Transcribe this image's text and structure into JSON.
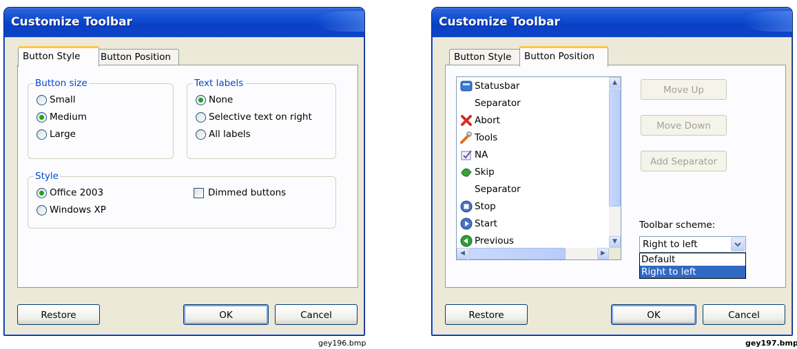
{
  "left_dialog": {
    "title": "Customize Toolbar",
    "tabs": [
      "Button Style",
      "Button Position"
    ],
    "active_tab": "Button Style",
    "button_size": {
      "legend": "Button size",
      "options": [
        "Small",
        "Medium",
        "Large"
      ],
      "selected": "Medium"
    },
    "text_labels": {
      "legend": "Text labels",
      "options": [
        "None",
        "Selective text on right",
        "All labels"
      ],
      "selected": "None"
    },
    "style": {
      "legend": "Style",
      "options": [
        "Office 2003",
        "Windows XP"
      ],
      "selected": "Office 2003",
      "dimmed_label": "Dimmed buttons",
      "dimmed_checked": false
    },
    "buttons": {
      "restore": "Restore",
      "ok": "OK",
      "cancel": "Cancel"
    },
    "caption": "gey196.bmp"
  },
  "right_dialog": {
    "title": "Customize Toolbar",
    "tabs": [
      "Button Style",
      "Button Position"
    ],
    "active_tab": "Button Position",
    "list_items": [
      {
        "label": "Statusbar",
        "icon": "statusbar-icon"
      },
      {
        "label": "Separator",
        "icon": ""
      },
      {
        "label": "Abort",
        "icon": "abort-icon"
      },
      {
        "label": "Tools",
        "icon": "tools-icon"
      },
      {
        "label": "NA",
        "icon": "na-icon"
      },
      {
        "label": "Skip",
        "icon": "skip-icon"
      },
      {
        "label": "Separator",
        "icon": ""
      },
      {
        "label": "Stop",
        "icon": "stop-icon"
      },
      {
        "label": "Start",
        "icon": "start-icon"
      },
      {
        "label": "Previous",
        "icon": "previous-icon"
      }
    ],
    "side_buttons": {
      "move_up": "Move Up",
      "move_down": "Move Down",
      "add_separator": "Add Separator"
    },
    "scheme_label": "Toolbar scheme:",
    "scheme_value": "Right to left",
    "scheme_options": [
      "Default",
      "Right to left"
    ],
    "scheme_highlighted": "Right to left",
    "buttons": {
      "restore": "Restore",
      "ok": "OK",
      "cancel": "Cancel"
    },
    "caption": "gey197.bmp"
  },
  "colors": {
    "title_bar": "#0b4ad0",
    "dialog_bg": "#ece9d8",
    "legend_text": "#0046d5",
    "selection": "#316ac5"
  }
}
